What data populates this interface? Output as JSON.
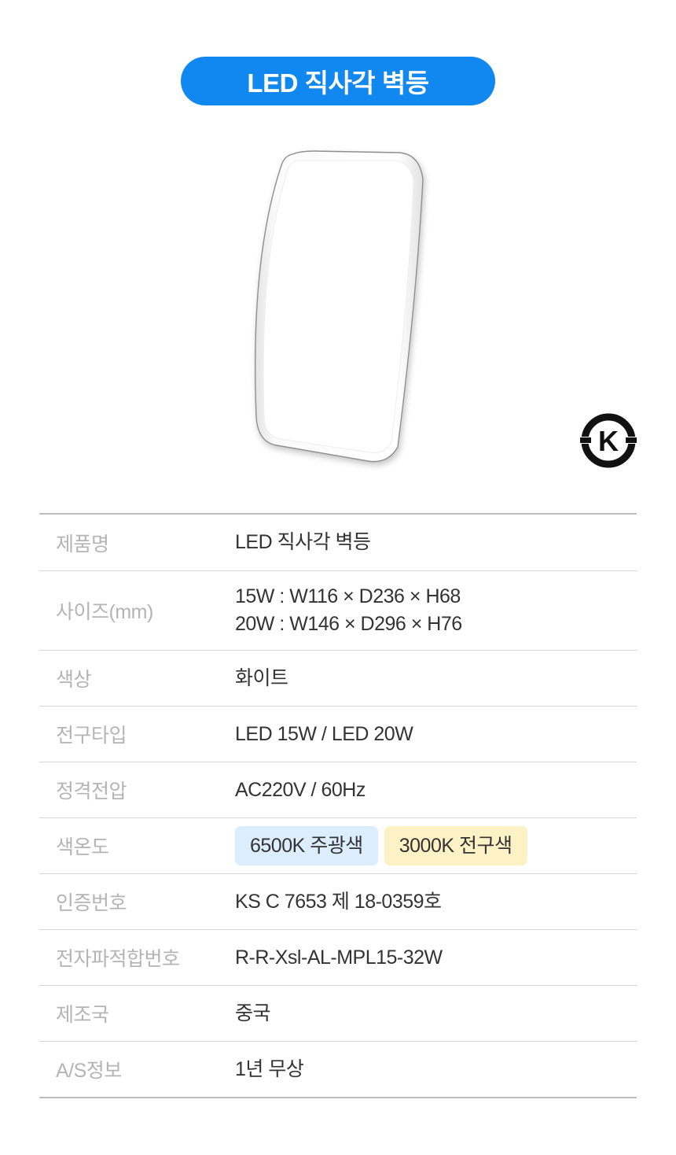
{
  "header": {
    "title": "LED 직사각 벽등",
    "accent_color": "#1188f0"
  },
  "product_image": {
    "icon": "rectangular-wall-lamp",
    "color": "#ffffff"
  },
  "certification_mark": {
    "icon": "ks-certification-mark",
    "letter": "K"
  },
  "specs": [
    {
      "label": "제품명",
      "value": "LED 직사각 벽등"
    },
    {
      "label": "사이즈(mm)",
      "lines": [
        "15W : W116 × D236 × H68",
        "20W : W146 × D296 × H76"
      ]
    },
    {
      "label": "색상",
      "value": "화이트"
    },
    {
      "label": "전구타입",
      "value": "LED 15W / LED 20W"
    },
    {
      "label": "정격전압",
      "value": "AC220V / 60Hz"
    },
    {
      "label": "색온도",
      "tags": [
        {
          "text": "6500K 주광색",
          "color": "#dcedfd"
        },
        {
          "text": "3000K 전구색",
          "color": "#fdf1c6"
        }
      ]
    },
    {
      "label": "인증번호",
      "value": "KS C 7653 제 18-0359호"
    },
    {
      "label": "전자파적합번호",
      "value": "R-R-Xsl-AL-MPL15-32W"
    },
    {
      "label": "제조국",
      "value": "중국"
    },
    {
      "label": "A/S정보",
      "value": "1년 무상"
    }
  ]
}
